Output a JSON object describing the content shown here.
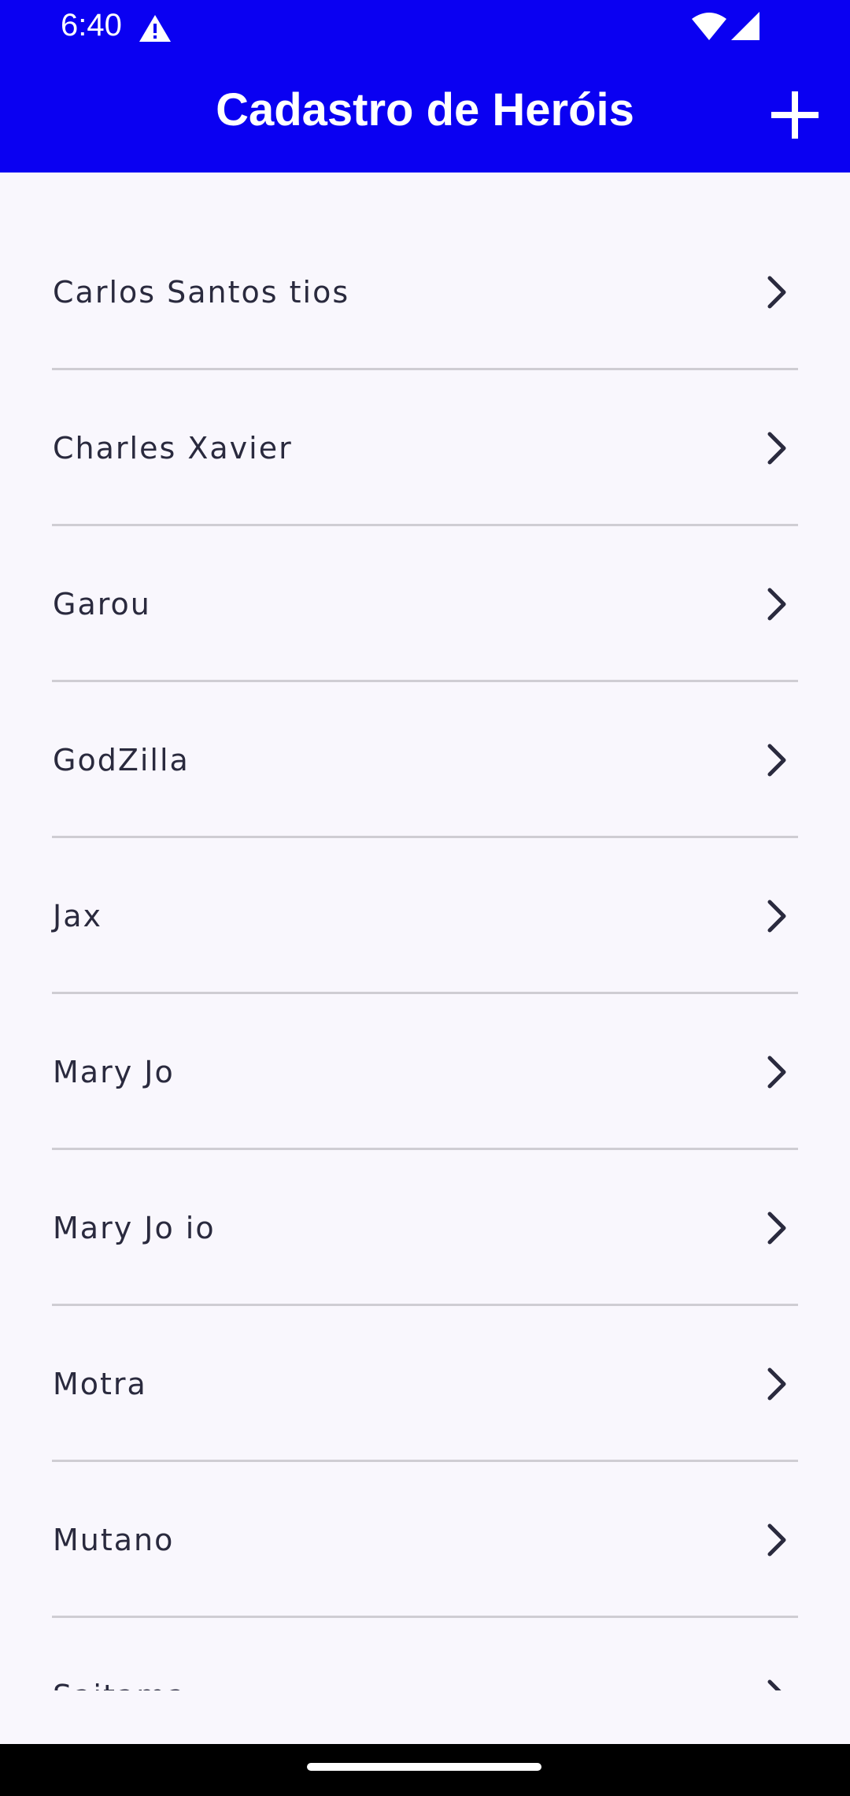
{
  "status_bar": {
    "time": "6:40",
    "icons": [
      "warning-icon",
      "wifi-icon",
      "signal-icon"
    ]
  },
  "app_bar": {
    "title": "Cadastro de Heróis",
    "action_icon": "add-icon",
    "background_color": "#0A00F2"
  },
  "heroes": [
    {
      "name": "Carlos Santos tios"
    },
    {
      "name": "Charles Xavier"
    },
    {
      "name": "Garou"
    },
    {
      "name": "GodZilla"
    },
    {
      "name": "Jax"
    },
    {
      "name": "Mary Jo"
    },
    {
      "name": "Mary Jo io"
    },
    {
      "name": "Motra"
    },
    {
      "name": "Mutano"
    },
    {
      "name": "Saitama"
    }
  ],
  "colors": {
    "accent": "#0A00F2",
    "background": "#F9F7FD",
    "text": "#2a2a3e",
    "divider": "#CFCDD3"
  }
}
